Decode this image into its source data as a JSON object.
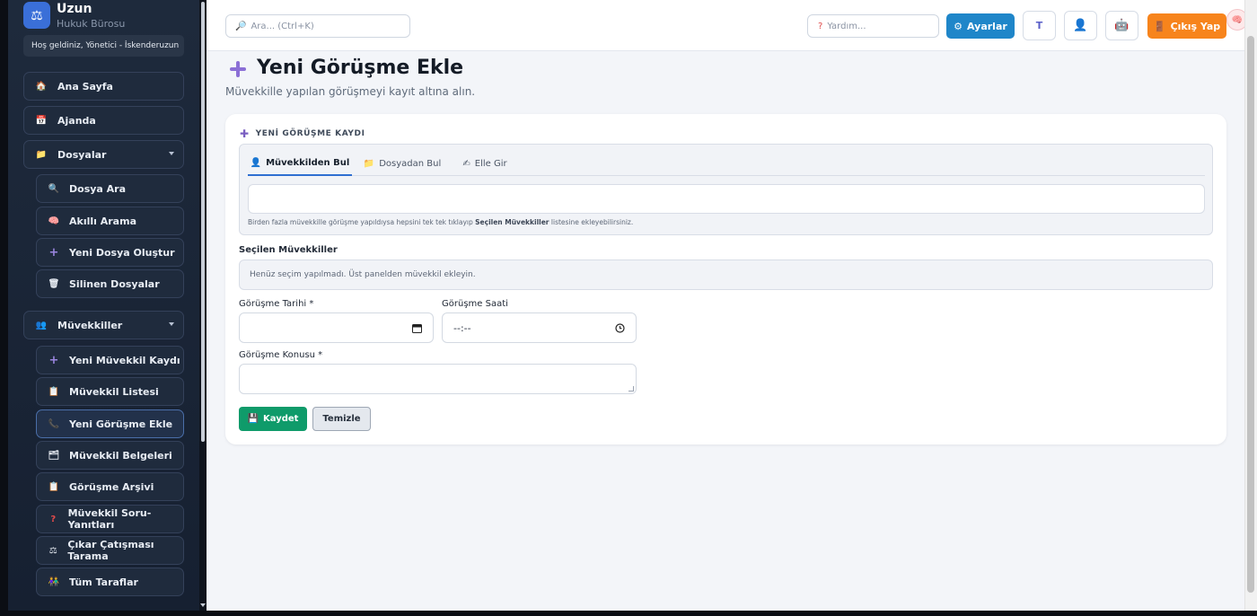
{
  "brand": {
    "name": "Uzun",
    "subtitle": "Hukuk Bürosu",
    "welcome": "Hoş geldiniz, Yönetici - İskenderuzun"
  },
  "sidebar": {
    "ana_sayfa": "Ana Sayfa",
    "ajanda": "Ajanda",
    "dosyalar": "Dosyalar",
    "dosya_ara": "Dosya Ara",
    "akilli_arama": "Akıllı Arama",
    "yeni_dosya": "Yeni Dosya Oluştur",
    "silinen_dosyalar": "Silinen Dosyalar",
    "muvekkiller": "Müvekkiller",
    "yeni_muvekkil": "Yeni Müvekkil Kaydı",
    "muvekkil_listesi": "Müvekkil Listesi",
    "yeni_gorusme": "Yeni Görüşme Ekle",
    "muvekkil_belgeleri": "Müvekkil Belgeleri",
    "gorusme_arsivi": "Görüşme Arşivi",
    "soru_yanitlari": "Müvekkil Soru-Yanıtları",
    "cikar_catismasi": "Çıkar Çatışması Tarama",
    "tum_taraflar": "Tüm Taraflar"
  },
  "topbar": {
    "search_placeholder": "Ara... (Ctrl+K)",
    "help_placeholder": "Yardım...",
    "settings_label": "Ayarlar",
    "logout_label": "Çıkış Yap"
  },
  "page": {
    "title": "Yeni Görüşme Ekle",
    "subtitle": "Müvekkille yapılan görüşmeyi kayıt altına alın."
  },
  "form": {
    "section_title": "YENİ GÖRÜŞME KAYDI",
    "tabs": [
      "Müvekkilden Bul",
      "Dosyadan Bul",
      "Elle Gir"
    ],
    "hint_prefix": "Birden fazla müvekkille görüşme yapıldıysa hepsini tek tek tıklayıp",
    "hint_bold": "Seçilen Müvekkiller",
    "hint_suffix": "listesine ekleyebilirsiniz.",
    "selected_label": "Seçilen Müvekkiller",
    "selected_empty": "Henüz seçim yapılmadı. Üst panelden müvekkil ekleyin.",
    "date_label": "Görüşme Tarihi *",
    "time_label": "Görüşme Saati",
    "time_value": "--:--",
    "topic_label": "Görüşme Konusu *",
    "save_label": "Kaydet",
    "clear_label": "Temizle"
  },
  "colors": {
    "accent": "#1f86c9",
    "logout": "#f7841c",
    "save": "#0f9b6a",
    "plus": "#7a5fc1"
  }
}
